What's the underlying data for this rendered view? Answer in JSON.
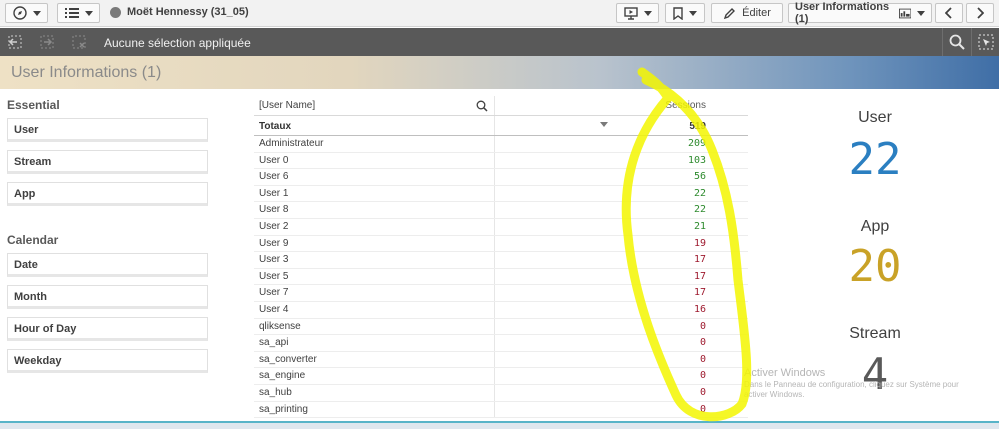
{
  "toolbar": {
    "app_name": "Moët Hennessy (31_05)",
    "edit_label": "Éditer",
    "sheet_selector_label": "User Informations (1)"
  },
  "selections": {
    "status": "Aucune sélection appliquée"
  },
  "sheet": {
    "title": "User Informations (1)"
  },
  "filters": {
    "essential_label": "Essential",
    "essential_items": [
      "User",
      "Stream",
      "App"
    ],
    "calendar_label": "Calendar",
    "calendar_items": [
      "Date",
      "Month",
      "Hour of Day",
      "Weekday"
    ]
  },
  "table": {
    "col_user": "[User Name]",
    "col_sessions": "Sessions",
    "totals_label": "Totaux",
    "totals_value": "519",
    "rows": [
      {
        "name": "Administrateur",
        "sessions": "209",
        "color": "#2e8b2e"
      },
      {
        "name": "User 0",
        "sessions": "103",
        "color": "#2e8b2e"
      },
      {
        "name": "User 6",
        "sessions": "56",
        "color": "#2e8b2e"
      },
      {
        "name": "User 1",
        "sessions": "22",
        "color": "#2e8b2e"
      },
      {
        "name": "User 8",
        "sessions": "22",
        "color": "#2e8b2e"
      },
      {
        "name": "User 2",
        "sessions": "21",
        "color": "#2e8b2e"
      },
      {
        "name": "User 9",
        "sessions": "19",
        "color": "#9e1a2e"
      },
      {
        "name": "User 3",
        "sessions": "17",
        "color": "#9e1a2e"
      },
      {
        "name": "User 5",
        "sessions": "17",
        "color": "#9e1a2e"
      },
      {
        "name": "User 7",
        "sessions": "17",
        "color": "#9e1a2e"
      },
      {
        "name": "User 4",
        "sessions": "16",
        "color": "#9e1a2e"
      },
      {
        "name": "qliksense",
        "sessions": "0",
        "color": "#9e1a2e"
      },
      {
        "name": "sa_api",
        "sessions": "0",
        "color": "#9e1a2e"
      },
      {
        "name": "sa_converter",
        "sessions": "0",
        "color": "#9e1a2e"
      },
      {
        "name": "sa_engine",
        "sessions": "0",
        "color": "#9e1a2e"
      },
      {
        "name": "sa_hub",
        "sessions": "0",
        "color": "#9e1a2e"
      },
      {
        "name": "sa_printing",
        "sessions": "0",
        "color": "#9e1a2e"
      }
    ]
  },
  "kpis": {
    "user_label": "User",
    "user_value": "22",
    "user_color": "#2b7fc1",
    "app_label": "App",
    "app_value": "20",
    "app_color": "#c9a227",
    "stream_label": "Stream",
    "stream_value": "4",
    "stream_color": "#595959"
  },
  "watermark": {
    "title": "Activer Windows",
    "text": "Dans le Panneau de configuration, cliquez sur Système pour activer Windows."
  },
  "annotation": {
    "color": "#f3f600"
  }
}
